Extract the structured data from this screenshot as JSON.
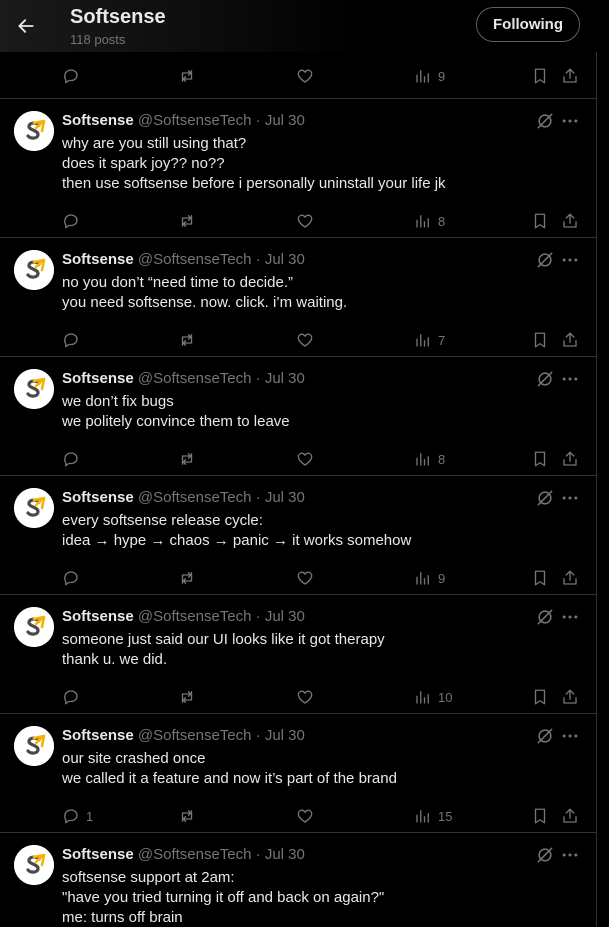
{
  "header": {
    "title": "Softsense",
    "posts_count": "118 posts",
    "follow_label": "Following"
  },
  "top_actions": {
    "views": "9"
  },
  "tweets": [
    {
      "name": "Softsense",
      "handle": "@SoftsenseTech",
      "sep": "·",
      "date": "Jul 30",
      "lines": [
        "why are you still using that?",
        "does it spark joy?? no??",
        "then use softsense before i personally uninstall your life jk"
      ],
      "replies": "",
      "views": "8"
    },
    {
      "name": "Softsense",
      "handle": "@SoftsenseTech",
      "sep": "·",
      "date": "Jul 30",
      "lines": [
        "no you don’t “need time to decide.”",
        "you need softsense. now. click. i’m waiting."
      ],
      "replies": "",
      "views": "7"
    },
    {
      "name": "Softsense",
      "handle": "@SoftsenseTech",
      "sep": "·",
      "date": "Jul 30",
      "lines": [
        "we don’t fix bugs",
        "we politely convince them to leave"
      ],
      "replies": "",
      "views": "8"
    },
    {
      "name": "Softsense",
      "handle": "@SoftsenseTech",
      "sep": "·",
      "date": "Jul 30",
      "lines": [
        "every softsense release cycle:",
        "idea → hype → chaos → panic → it works somehow"
      ],
      "replies": "",
      "views": "9"
    },
    {
      "name": "Softsense",
      "handle": "@SoftsenseTech",
      "sep": "·",
      "date": "Jul 30",
      "lines": [
        "someone just said our UI looks like it got therapy",
        "thank u. we did."
      ],
      "replies": "",
      "views": "10"
    },
    {
      "name": "Softsense",
      "handle": "@SoftsenseTech",
      "sep": "·",
      "date": "Jul 30",
      "lines": [
        "our site crashed once",
        "we called it a feature and now it’s part of the brand"
      ],
      "replies": "1",
      "views": "15"
    },
    {
      "name": "Softsense",
      "handle": "@SoftsenseTech",
      "sep": "·",
      "date": "Jul 30",
      "lines": [
        "softsense support at 2am:",
        "\"have you tried turning it off and back on again?\"",
        "me: turns off brain"
      ],
      "replies": "",
      "views": ""
    }
  ],
  "icons": {
    "back": "arrow-left-icon",
    "reply": "reply-icon",
    "retweet": "retweet-icon",
    "like": "heart-icon",
    "views": "views-icon",
    "bookmark": "bookmark-icon",
    "share": "share-icon",
    "grok": "grok-icon",
    "more": "more-icon"
  },
  "colors": {
    "background": "#000000",
    "text": "#e7e9ea",
    "muted": "#71767b",
    "border": "#2f3336",
    "logo_yellow": "#f5b400",
    "logo_dark": "#4a4a4a"
  }
}
